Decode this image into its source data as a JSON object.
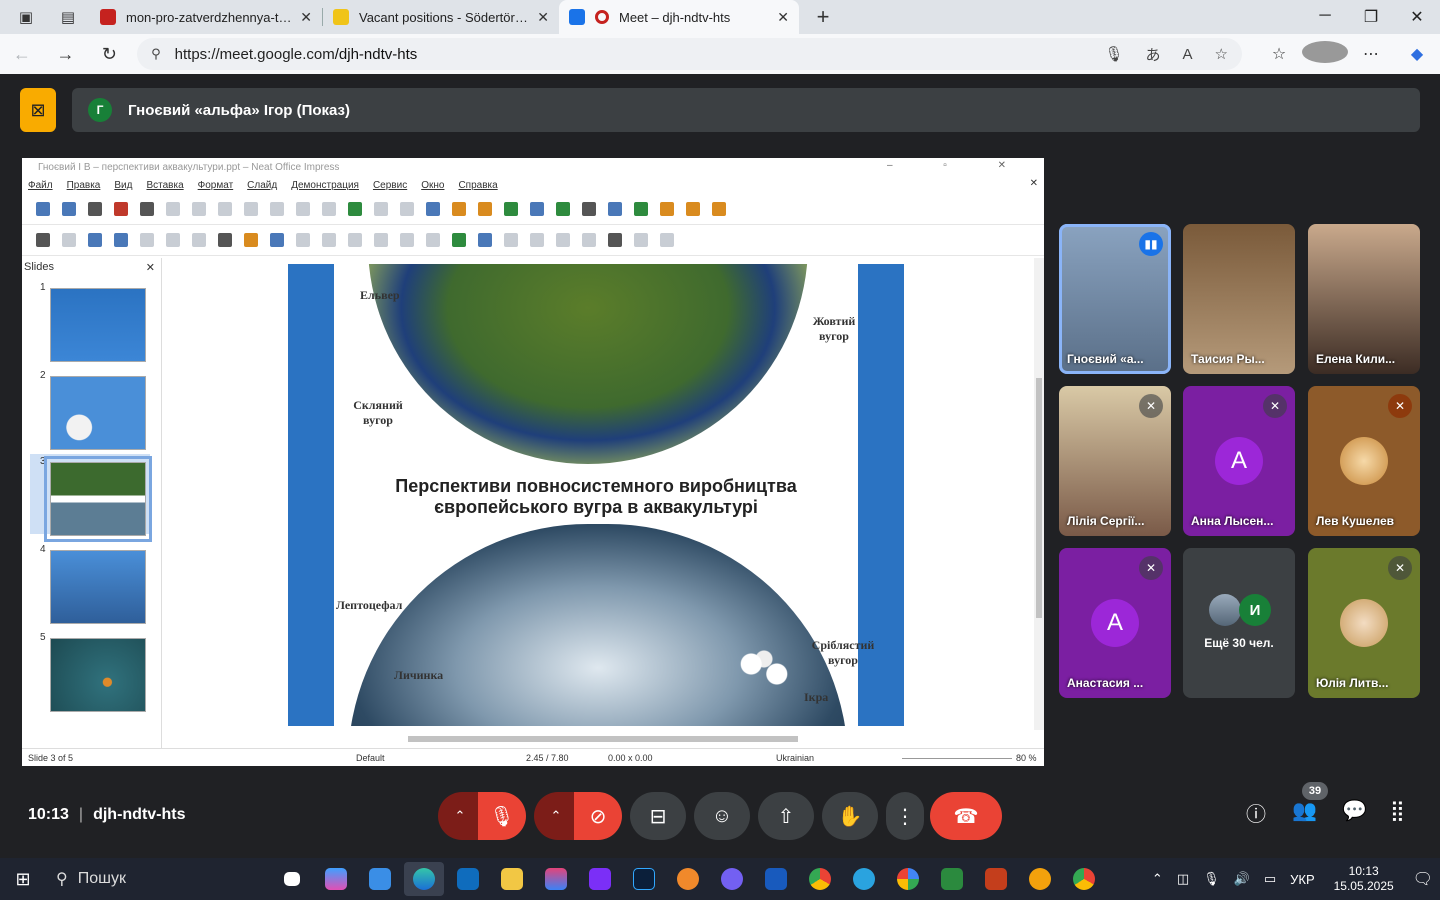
{
  "browser": {
    "tabs": [
      {
        "label": "mon-pro-zatverdzhennya-tematik",
        "favicon_color": "#c5221f",
        "active": false
      },
      {
        "label": "Vacant positions - Södertörns hög",
        "favicon_color": "#f0c419",
        "active": false
      },
      {
        "label": "Meet – djh-ndtv-hts",
        "favicon_color": "#1a73e8",
        "active": true
      }
    ],
    "url_host": "https://meet.google.com",
    "url_path": "/djh-ndtv-hts"
  },
  "meet": {
    "presenter_label": "Гноєвий «альфа» Ігор (Показ)",
    "presenter_initial": "Г",
    "meeting_code": "djh-ndtv-hts",
    "time": "10:13",
    "participants_count": "39",
    "participants": [
      {
        "name": "Гноєвий «а...",
        "type": "video",
        "speaking": true
      },
      {
        "name": "Таисия Ры...",
        "type": "video"
      },
      {
        "name": "Елена Кили...",
        "type": "video"
      },
      {
        "name": "Лілія Сергії...",
        "type": "video",
        "muted": true
      },
      {
        "name": "Анна Лысен...",
        "type": "letter",
        "letter": "A",
        "muted": true
      },
      {
        "name": "Лев Кушелев",
        "type": "avatar",
        "muted": true
      },
      {
        "name": "Анастасия ...",
        "type": "letter",
        "letter": "A",
        "muted": true
      },
      {
        "name": "Ещё 30 чел.",
        "type": "more",
        "initial": "И"
      },
      {
        "name": "Юлія Литв...",
        "type": "avatar",
        "muted": true
      }
    ]
  },
  "impress": {
    "window_title": "Гноєвий І В – перспективи аквакультури.ppt – Neat Office Impress",
    "menu": [
      "Файл",
      "Правка",
      "Вид",
      "Вставка",
      "Формат",
      "Слайд",
      "Демонстрация",
      "Сервис",
      "Окно",
      "Справка"
    ],
    "slides_pane_title": "Slides",
    "slide_numbers": [
      "1",
      "2",
      "3",
      "4",
      "5"
    ],
    "slide": {
      "title_line1": "Перспективи повносистемного виробництва",
      "title_line2": "європейського вугра в аквакультурі",
      "labels": {
        "elver": "Ельвер",
        "yellow": "Жовтий вугор",
        "glass": "Скляний вугор",
        "lepto": "Лептоцефал",
        "silver": "Сріблястий вугор",
        "larva": "Личинка",
        "roe": "Ікра"
      }
    },
    "status": {
      "slide": "Slide 3 of 5",
      "layout": "Default",
      "position": "2.45 / 7.80",
      "size": "0.00 x 0.00",
      "language": "Ukrainian",
      "zoom": "80 %"
    }
  },
  "taskbar": {
    "search_placeholder": "Пошук",
    "lang": "УКР",
    "clock_time": "10:13",
    "clock_date": "15.05.2025"
  }
}
